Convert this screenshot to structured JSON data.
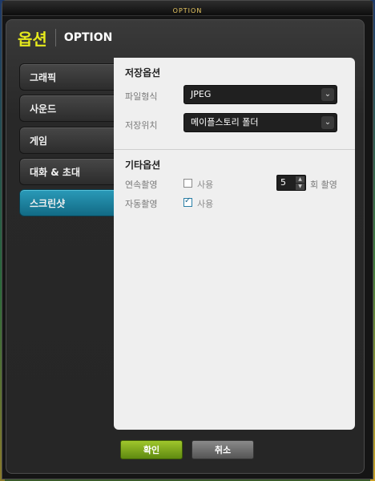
{
  "window": {
    "title": "OPTION"
  },
  "header": {
    "title_kr": "옵션",
    "title_en": "OPTION"
  },
  "tabs": [
    {
      "label": "그래픽",
      "active": false
    },
    {
      "label": "사운드",
      "active": false
    },
    {
      "label": "게임",
      "active": false
    },
    {
      "label": "대화 & 초대",
      "active": false
    },
    {
      "label": "스크린샷",
      "active": true
    }
  ],
  "save_options": {
    "title": "저장옵션",
    "file_format": {
      "label": "파일형식",
      "value": "JPEG"
    },
    "save_location": {
      "label": "저장위치",
      "value": "메이플스토리 폴더"
    }
  },
  "other_options": {
    "title": "기타옵션",
    "burst": {
      "label": "연속촬영",
      "checkbox_label": "사용",
      "checked": false,
      "count": "5",
      "count_suffix": "회 촬영"
    },
    "auto": {
      "label": "자동촬영",
      "checkbox_label": "사용",
      "checked": true
    }
  },
  "buttons": {
    "ok": "확인",
    "cancel": "취소"
  },
  "colors": {
    "accent": "#1d86a3",
    "brand": "#e6ea1c",
    "ok_button": "#7aa81c"
  }
}
